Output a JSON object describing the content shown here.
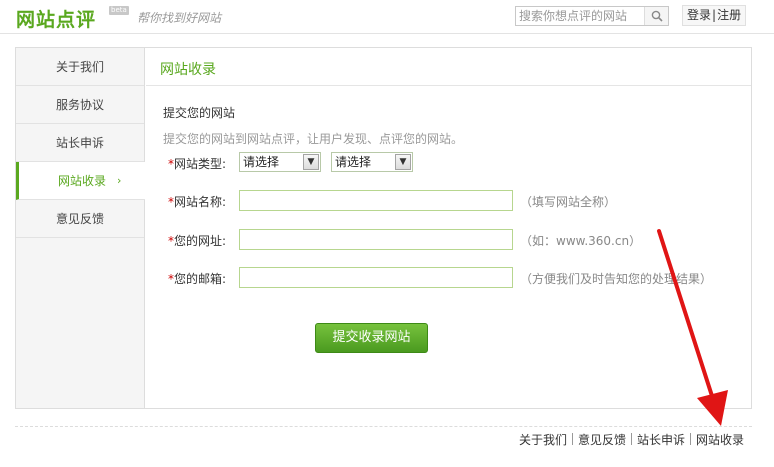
{
  "header": {
    "logo": "网站点评",
    "beta": "beta",
    "slogan": "帮你找到好网站",
    "search_placeholder": "搜索你想点评的网站",
    "login": "登录",
    "register": "注册"
  },
  "sidebar": {
    "items": [
      {
        "label": "关于我们"
      },
      {
        "label": "服务协议"
      },
      {
        "label": "站长申诉"
      },
      {
        "label": "网站收录"
      },
      {
        "label": "意见反馈"
      }
    ],
    "active_chevron": "›"
  },
  "content": {
    "title": "网站收录",
    "subtitle": "提交您的网站",
    "description": "提交您的网站到网站点评，让用户发现、点评您的网站。",
    "required_mark": "*",
    "type_label": "网站类型:",
    "select1": "请选择",
    "select2": "请选择",
    "name_label": "网站名称:",
    "name_hint": "（填写网站全称）",
    "url_label": "您的网址:",
    "url_hint": "（如：www.360.cn）",
    "email_label": "您的邮箱:",
    "email_hint": "（方便我们及时告知您的处理结果）",
    "submit": "提交收录网站"
  },
  "footer": {
    "links": [
      "关于我们",
      "意见反馈",
      "站长申诉",
      "网站收录"
    ]
  },
  "colors": {
    "brand_green": "#5aa81f",
    "annotation_red": "#e01515"
  }
}
